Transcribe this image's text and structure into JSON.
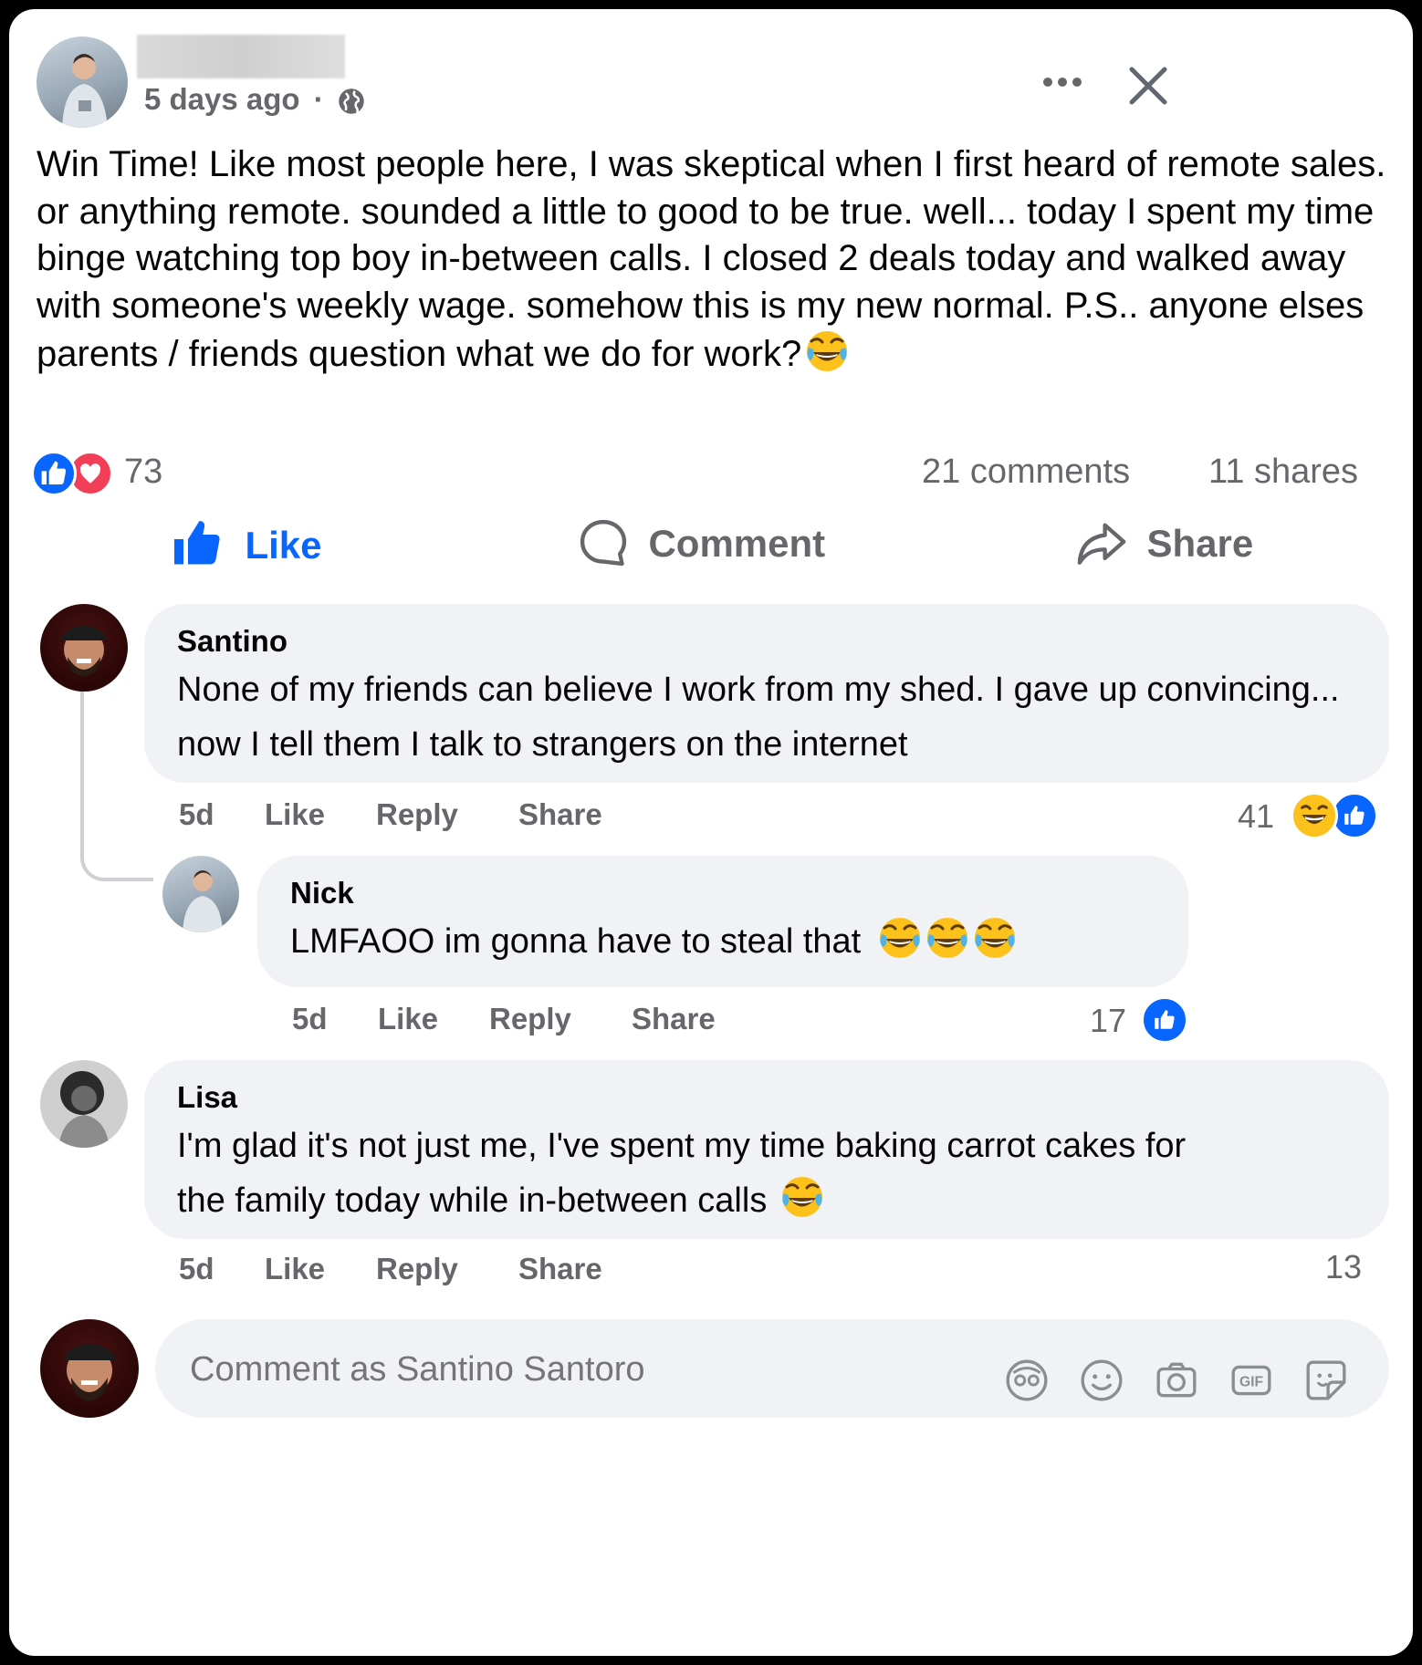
{
  "post": {
    "time": "5 days ago",
    "separator": "·",
    "body": "Win Time! Like most people here, I was skeptical when I first heard of remote sales. or anything remote. sounded a little to good to be true. well... today I spent my time binge watching top boy in-between calls. I closed 2 deals today and walked away with someone's weekly wage. somehow this is my new normal. P.S.. anyone elses parents / friends question what we do for work?",
    "reaction_count": "73",
    "comments_count": "21 comments",
    "shares_count": "11 shares"
  },
  "actions": {
    "like": "Like",
    "comment": "Comment",
    "share": "Share"
  },
  "comments": [
    {
      "author": "Santino",
      "text": "None of my friends can believe I work from my shed. I gave up convincing... now I tell them I talk to strangers on the internet",
      "time": "5d",
      "like": "Like",
      "reply": "Reply",
      "share": "Share",
      "reactions": "41"
    },
    {
      "author": "Nick",
      "text": "LMFAOO im gonna have to steal that",
      "time": "5d",
      "like": "Like",
      "reply": "Reply",
      "share": "Share",
      "reactions": "17"
    },
    {
      "author": "Lisa",
      "text": "I'm glad it's not just me, I've spent my time baking carrot cakes for the family today while in-between calls",
      "time": "5d",
      "like": "Like",
      "reply": "Reply",
      "share": "Share",
      "reactions": "13"
    }
  ],
  "composer": {
    "placeholder": "Comment as Santino Santoro"
  },
  "colors": {
    "facebook_blue": "#0866ff",
    "love_red": "#f33e58",
    "bubble_gray": "#f0f2f5",
    "secondary_text": "#65676b"
  }
}
